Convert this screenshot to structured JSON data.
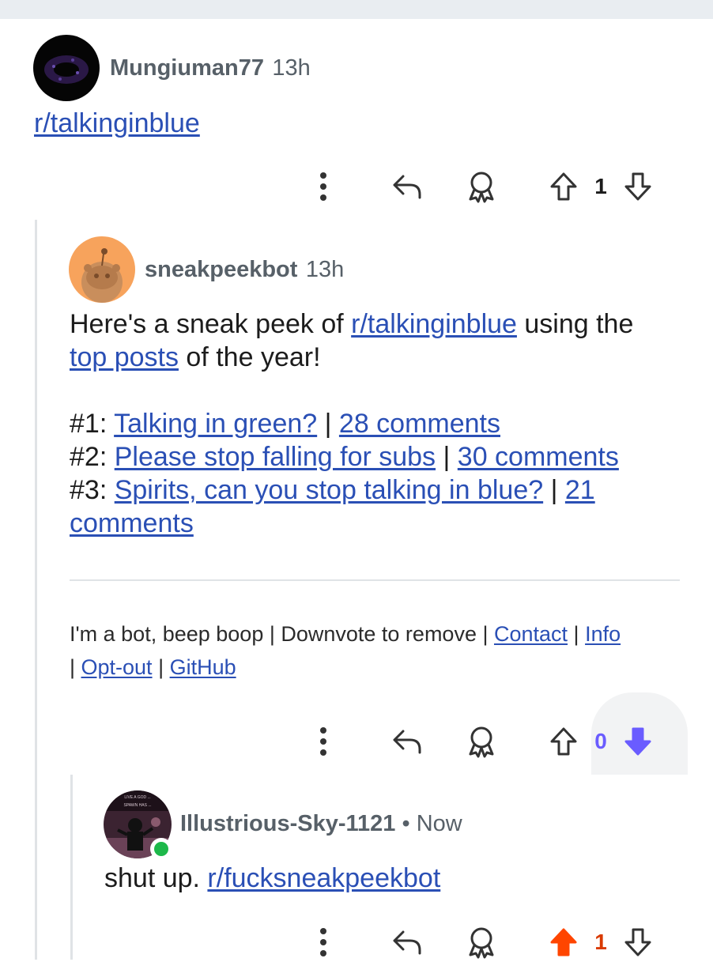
{
  "colors": {
    "link": "#2a4fb5",
    "meta": "#576068",
    "upvote_active": "#ff4500",
    "downvote_active": "#6a5cff",
    "online": "#1db84a",
    "thread_line": "#e0e3e6"
  },
  "comments": [
    {
      "username": "Mungiuman77",
      "time": "13h",
      "link_text": "r/talkinginblue",
      "score": "1",
      "vote_state": "none"
    },
    {
      "username": "sneakpeekbot",
      "time": "13h",
      "intro_1": "Here's a sneak peek of ",
      "intro_link": "r/talkinginblue",
      "intro_2": " using the ",
      "intro_link2": "top posts",
      "intro_3": " of the year!",
      "posts": [
        {
          "num": "#1: ",
          "title": "Talking in green?",
          "sep": " | ",
          "comments": "28 comments"
        },
        {
          "num": "#2: ",
          "title": "Please stop falling for subs",
          "sep": " | ",
          "comments": "30 comments"
        },
        {
          "num": "#3: ",
          "title": "Spirits, can you stop talking in blue?",
          "sep": " | ",
          "comments_a": "21",
          "comments_b": "comments"
        }
      ],
      "footer_plain": "I'm a bot, beep boop | Downvote to remove | ",
      "footer_links": [
        "Contact",
        "Info",
        "Opt-out",
        "GitHub"
      ],
      "footer_sep": " | ",
      "score": "0",
      "vote_state": "down"
    },
    {
      "username": "Illustrious-Sky-1121",
      "dot": " • ",
      "time": "Now",
      "text": "shut up. ",
      "link_text": "r/fucksneakpeekbot",
      "score": "1",
      "vote_state": "up"
    }
  ],
  "icons": [
    "more-vertical-icon",
    "reply-icon",
    "award-icon",
    "upvote-icon",
    "downvote-icon"
  ]
}
